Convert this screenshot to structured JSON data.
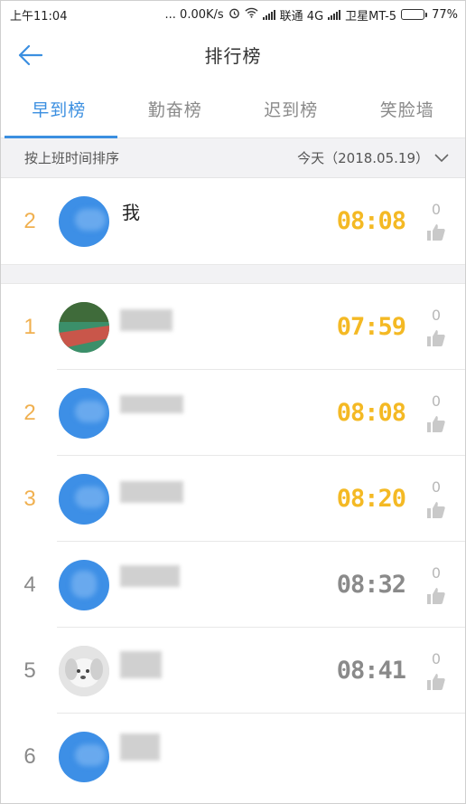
{
  "status_bar": {
    "time": "上午11:04",
    "net_speed": "... 0.00K/s",
    "carrier1": "联通 4G",
    "carrier2": "卫星MT-5",
    "battery": "77%",
    "battery_level": 0.77
  },
  "header": {
    "title": "排行榜"
  },
  "tabs": [
    {
      "label": "早到榜",
      "active": true
    },
    {
      "label": "勤奋榜",
      "active": false
    },
    {
      "label": "迟到榜",
      "active": false
    },
    {
      "label": "笑脸墙",
      "active": false
    }
  ],
  "sort_bar": {
    "label": "按上班时间排序",
    "date": "今天（2018.05.19）"
  },
  "my_entry": {
    "rank": "2",
    "name": "我",
    "time": "08:08",
    "likes": "0"
  },
  "ranking": [
    {
      "rank": "1",
      "time": "07:59",
      "likes": "0"
    },
    {
      "rank": "2",
      "time": "08:08",
      "likes": "0"
    },
    {
      "rank": "3",
      "time": "08:20",
      "likes": "0"
    },
    {
      "rank": "4",
      "time": "08:32",
      "likes": "0"
    },
    {
      "rank": "5",
      "time": "08:41",
      "likes": "0"
    },
    {
      "rank": "6",
      "time": "",
      "likes": ""
    }
  ],
  "colors": {
    "accent": "#3b8fe0",
    "rank_top": "#f0b050",
    "time_top": "#f4b924",
    "muted": "#8a8a8a"
  }
}
